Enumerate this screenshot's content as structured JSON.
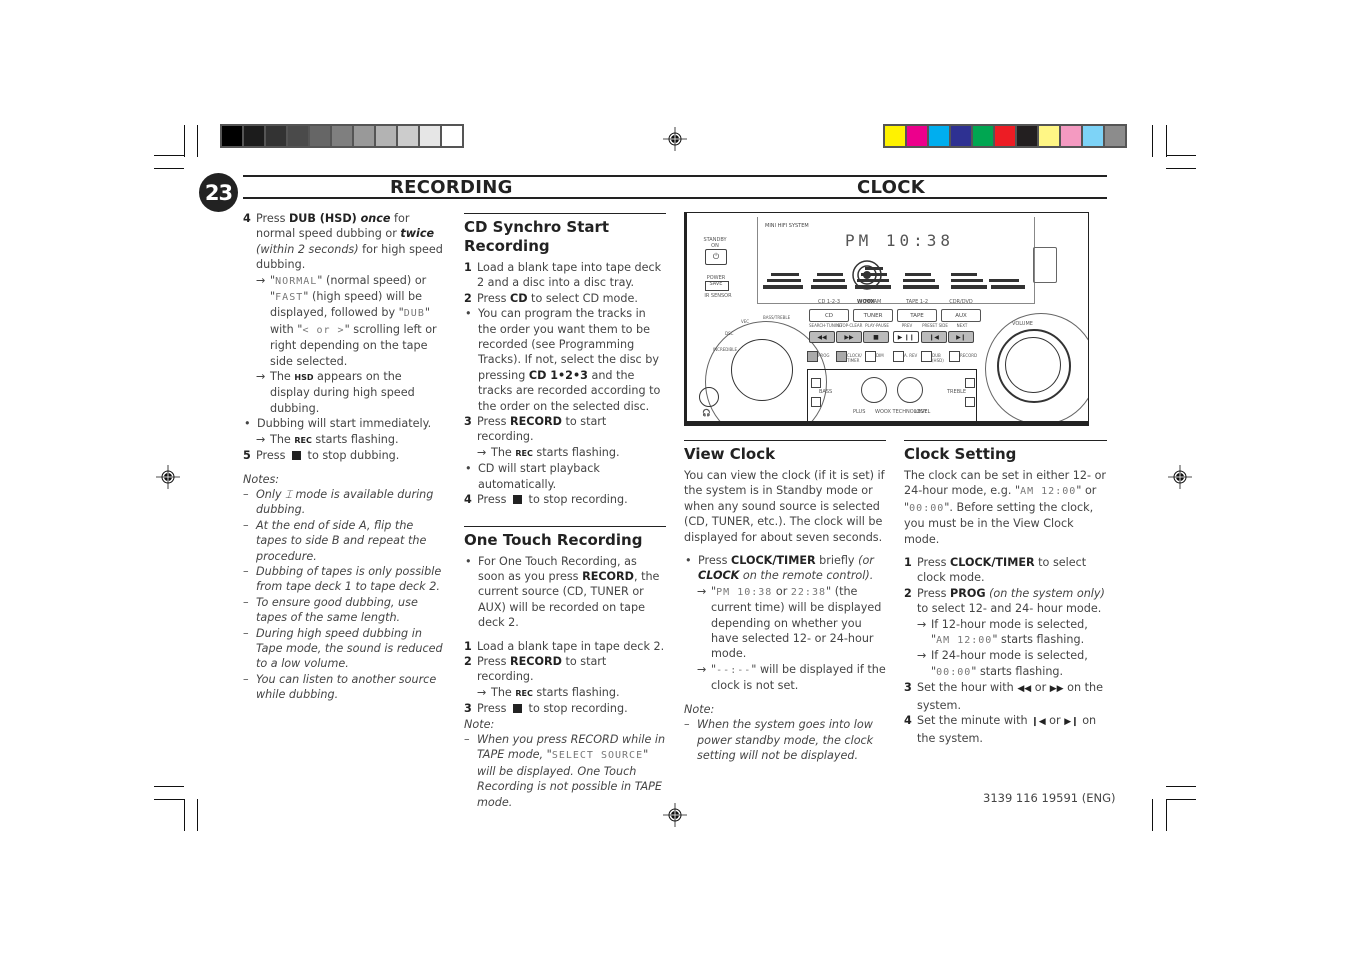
{
  "page": {
    "number": "23",
    "left_title": "RECORDING",
    "right_title": "CLOCK",
    "footer_code": "3139 116 19591 (ENG)"
  },
  "calibration": {
    "gray_bar": [
      "#000000",
      "#1c1c1c",
      "#333333",
      "#4a4a4a",
      "#666666",
      "#7f7f7f",
      "#999999",
      "#b3b3b3",
      "#cccccc",
      "#e6e6e6",
      "#ffffff"
    ],
    "color_bar": [
      "#fff200",
      "#ec008c",
      "#00aeef",
      "#2e3192",
      "#00a651",
      "#ed1c24",
      "#231f20",
      "#fff685",
      "#f49ac1",
      "#7dd3f7",
      "#8c8c8c"
    ]
  },
  "col1": {
    "step4": {
      "num": "4",
      "t1": "Press ",
      "b1": "DUB (HSD) ",
      "bi1": "once",
      "t2": " for normal speed dubbing or ",
      "bi2": "twice",
      "i1": " (within 2 seconds)",
      "t3": " for high speed dubbing."
    },
    "arrow1": {
      "t1": "\"",
      "lcd1": "NORMAL",
      "t2": "\" (normal speed) or \"",
      "lcd2": "FAST",
      "t3": "\" (high speed) will be displayed, followed by \"",
      "lcd3": "DUB",
      "t4": "\" with \"",
      "lcd4": "< or >",
      "t5": "\" scrolling left or right depending on the tape side selected."
    },
    "arrow2": {
      "t1": "The ",
      "sc": "HSD",
      "t2": " appears on the display during high speed dubbing."
    },
    "bullet1": "Dubbing will start immediately.",
    "arrow3": {
      "t1": "The ",
      "sc": "REC",
      "t2": " starts flashing."
    },
    "step5": {
      "num": "5",
      "t1": "Press ",
      "t2": " to stop dubbing."
    },
    "notes_label": "Notes:",
    "notes": [
      "Only ⌶ mode is available during dubbing.",
      "At the end of side A, flip the tapes to side B and repeat the procedure.",
      "Dubbing of tapes is only possible from tape deck 1 to tape deck 2.",
      "To ensure good dubbing, use tapes of the same length.",
      "During high speed dubbing in Tape mode, the sound is reduced to a low volume.",
      "You can listen to another source while dubbing."
    ]
  },
  "col2": {
    "cd_synchro": {
      "heading": "CD Synchro Start Recording",
      "s1": {
        "num": "1",
        "text": "Load a blank tape into tape deck 2 and a disc into a disc tray."
      },
      "s2": {
        "num": "2",
        "t1": "Press ",
        "b": "CD",
        "t2": " to select CD mode."
      },
      "bullet": {
        "t1": "You can program the tracks in the order you want them to be recorded (see Programming Tracks). If not, select the disc by pressing ",
        "b": "CD 1•2•3",
        "t2": " and the tracks are recorded according to the order on the selected disc."
      },
      "s3": {
        "num": "3",
        "t1": "Press ",
        "b": "RECORD",
        "t2": " to start recording."
      },
      "arrow": {
        "t1": "The ",
        "sc": "REC",
        "t2": " starts flashing."
      },
      "bullet2": "CD will start playback automatically.",
      "s4": {
        "num": "4",
        "t1": "Press ",
        "t2": " to stop recording."
      }
    },
    "one_touch": {
      "heading": "One Touch Recording",
      "bullet": {
        "t1": "For One Touch Recording, as soon as you press ",
        "b": "RECORD",
        "t2": ", the current source (CD, TUNER or AUX) will be recorded on tape deck 2."
      },
      "s1": {
        "num": "1",
        "text": "Load a blank tape in tape deck 2."
      },
      "s2": {
        "num": "2",
        "t1": "Press ",
        "b": "RECORD",
        "t2": " to start recording."
      },
      "arrow": {
        "t1": "The ",
        "sc": "REC",
        "t2": " starts flashing."
      },
      "s3": {
        "num": "3",
        "t1": "Press ",
        "t2": " to stop recording."
      },
      "note_label": "Note:",
      "note": {
        "t1": "When you press RECORD while in TAPE mode, \"",
        "lcd": "SELECT SOURCE",
        "t2": "\" will be displayed.  One Touch Recording is not possible in TAPE mode."
      }
    }
  },
  "device": {
    "brand_line": "MINI HIFI SYSTEM",
    "display_time": "PM 10:38",
    "woox": "WOOX",
    "standby_label": "STANDBY ON",
    "power_save": "POWER SAVE",
    "ir_sensor": "IR SENSOR",
    "source_labels": [
      "CD 1-2-3",
      "FM-AM",
      "TAPE 1-2",
      "CDR/DVD"
    ],
    "source_buttons": [
      "CD",
      "TUNER",
      "TAPE",
      "AUX"
    ],
    "transport_labels": [
      "SEARCH·TUNING",
      "STOP·CLEAR",
      "PLAY·PAUSE",
      "PREV",
      "PRESET SIDE",
      "NEXT"
    ],
    "transport_icons": [
      "◀◀",
      "▶▶",
      "■",
      "▶ ❙❙",
      "❙◀",
      "▶❙"
    ],
    "func_buttons": [
      "PROG",
      "CLOCK/ TIMER",
      "DIM",
      "A. REV",
      "DUB (HSD)",
      "RECORD"
    ],
    "volume": "VOLUME",
    "bass": "BASS",
    "treble": "TREBLE",
    "woox_tech": [
      "PLUS",
      "WOOX TECHNOLOGY",
      "LEVEL"
    ],
    "jog_labels": [
      "DSC",
      "VEC",
      "BASS/TREBLE",
      "INCREDIBLE"
    ]
  },
  "col3": {
    "heading": "View Clock",
    "intro": "You can view the clock (if it is set) if the system is in Standby mode or when any sound source is selected (CD, TUNER, etc.). The clock will be displayed for about seven seconds.",
    "bullet": {
      "t1": "Press ",
      "b": "CLOCK/TIMER",
      "t2": " briefly ",
      "i1": "(or ",
      "bi": "CLOCK",
      "i2": " on the remote control)."
    },
    "arrow1": {
      "t1": "\"",
      "lcd1": "PM  10:38",
      "t2": " or ",
      "lcd2": "22:38",
      "t3": "\" (the current time) will be displayed depending on whether you have selected 12- or 24-hour mode."
    },
    "arrow2": {
      "t1": "\"",
      "lcd": "--:--",
      "t2": "\" will be displayed if the clock is not set."
    },
    "note_label": "Note:",
    "note": "When the system goes into low power standby mode, the clock setting will not be displayed."
  },
  "col4": {
    "heading": "Clock Setting",
    "intro": {
      "t1": "The clock can be set in either 12- or 24-hour mode, e.g. \"",
      "lcd1": "AM  12:00",
      "t2": "\" or \"",
      "lcd2": "00:00",
      "t3": "\". Before setting the clock, you must be in the View Clock mode."
    },
    "s1": {
      "num": "1",
      "t1": "Press ",
      "b": "CLOCK/TIMER",
      "t2": " to select clock mode."
    },
    "s2": {
      "num": "2",
      "t1": "Press ",
      "b": "PROG",
      "i": " (on the system only)",
      "t2": " to select 12- and 24- hour mode."
    },
    "arrow1": {
      "t1": "If 12-hour mode is selected, \"",
      "lcd": "AM 12:00",
      "t2": "\" starts flashing."
    },
    "arrow2": {
      "t1": "If 24-hour mode is selected, \"",
      "lcd": "00:00",
      "t2": "\" starts flashing."
    },
    "s3": {
      "num": "3",
      "t1": "Set the hour with ",
      "ic1": "◀◀",
      "t2": " or ",
      "ic2": "▶▶",
      "t3": " on the system."
    },
    "s4": {
      "num": "4",
      "t1": "Set the minute with ",
      "ic1": "❙◀",
      "t2": " or ",
      "ic2": "▶❙",
      "t3": " on the system."
    }
  }
}
